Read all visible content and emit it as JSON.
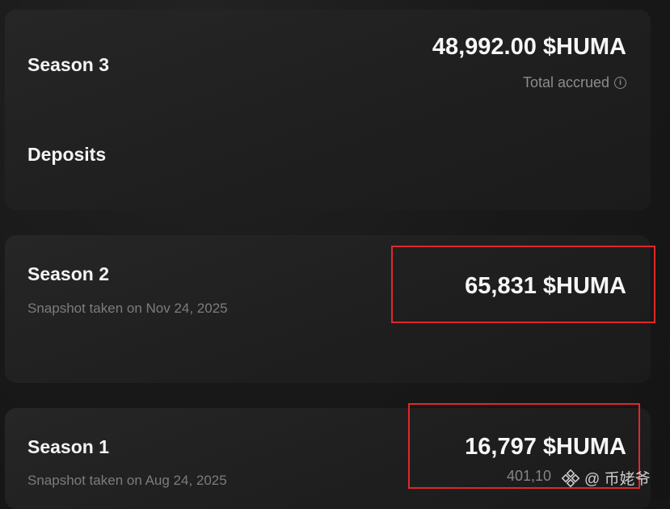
{
  "season3": {
    "title": "Season 3",
    "amount": "48,992.00 $HUMA",
    "total_label": "Total accrued",
    "info_icon": "info-circle-icon",
    "deposits_label": "Deposits"
  },
  "season2": {
    "title": "Season 2",
    "snapshot": "Snapshot taken on Nov 24, 2025",
    "amount": "65,831 $HUMA"
  },
  "season1": {
    "title": "Season 1",
    "snapshot": "Snapshot taken on Aug 24, 2025",
    "amount": "16,797 $HUMA"
  },
  "overlay": {
    "partial_number": "401,10",
    "watermark_logo": "binance-diamond-icon",
    "watermark_text": "@ 币姥爷"
  },
  "colors": {
    "highlight": "#e0282a",
    "background": "#161616",
    "card": "#232323"
  }
}
